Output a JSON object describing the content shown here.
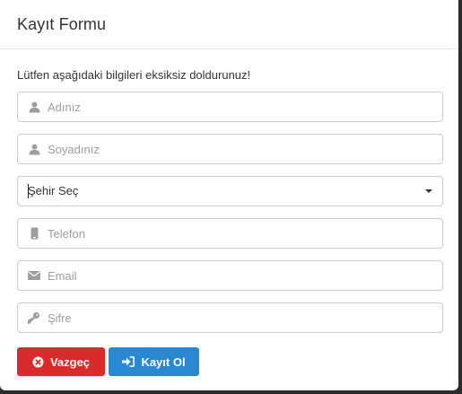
{
  "modal": {
    "title": "Kayıt Formu",
    "intro": "Lütfen aşağıdaki bilgileri eksiksiz doldurunuz!"
  },
  "form": {
    "first_name": {
      "placeholder": "Adınız",
      "icon": "user-icon"
    },
    "last_name": {
      "placeholder": "Soyadınız",
      "icon": "user-icon"
    },
    "city": {
      "selected": "Şehir Seç"
    },
    "phone": {
      "placeholder": "Telefon",
      "icon": "mobile-phone-icon"
    },
    "email": {
      "placeholder": "Email",
      "icon": "envelope-icon"
    },
    "password": {
      "placeholder": "Şifre",
      "icon": "key-icon"
    }
  },
  "buttons": {
    "cancel_label": "Vazgeç",
    "submit_label": "Kayıt Ol"
  },
  "colors": {
    "cancel": "#d92b2b",
    "submit": "#2a87d2",
    "icon": "#9e9e9e"
  }
}
